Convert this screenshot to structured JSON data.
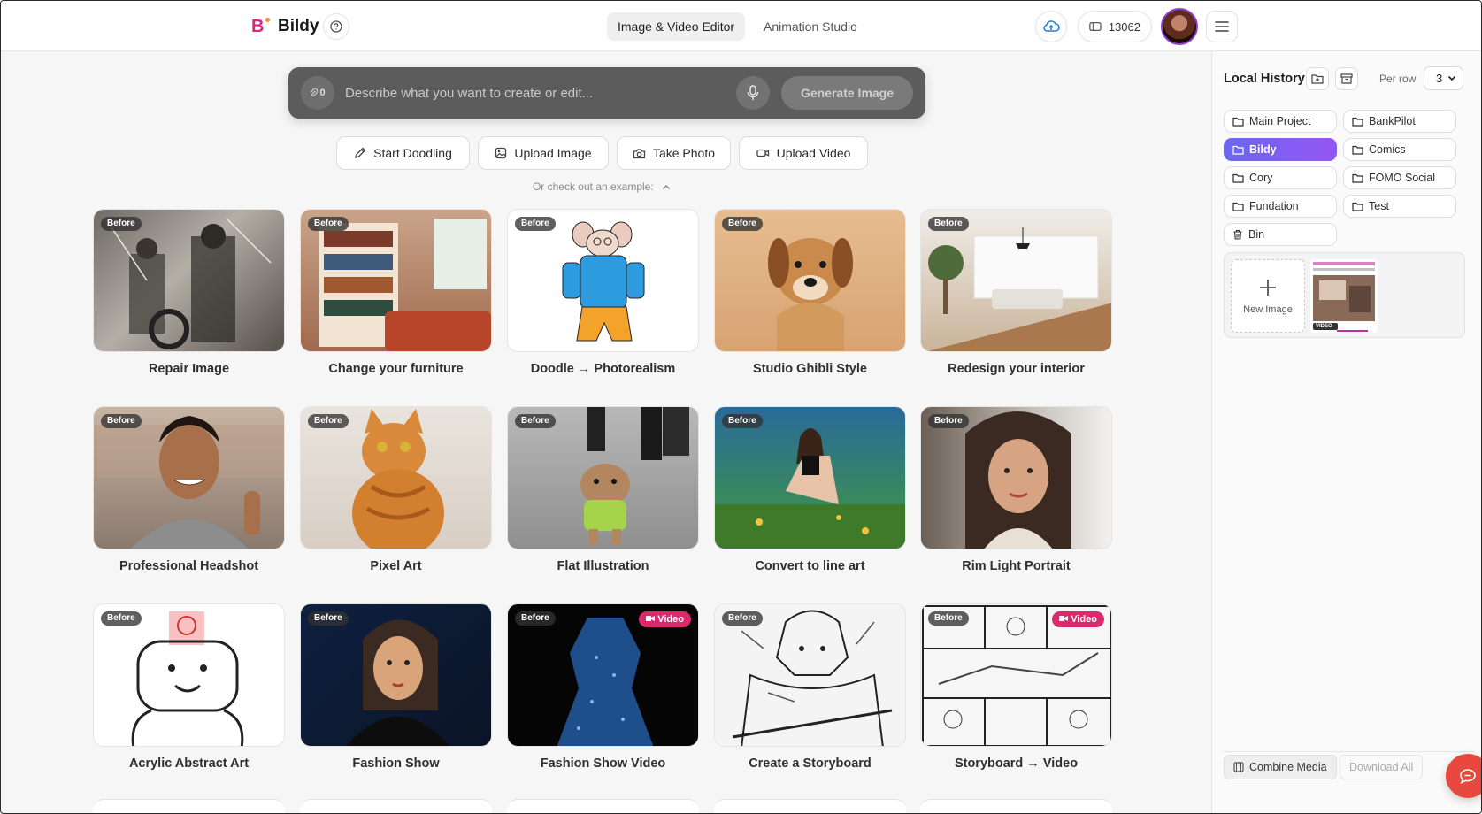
{
  "header": {
    "brand": "Bildy",
    "tabs": [
      {
        "label": "Image & Video Editor",
        "active": true
      },
      {
        "label": "Animation Studio",
        "active": false
      }
    ],
    "credits": "13062"
  },
  "prompt": {
    "attach_count": "0",
    "placeholder": "Describe what you want to create or edit...",
    "generate_label": "Generate Image"
  },
  "actions": {
    "doodle": "Start Doodling",
    "upload_image": "Upload Image",
    "take_photo": "Take Photo",
    "upload_video": "Upload Video"
  },
  "example_text": "Or check out an example:",
  "badge_before": "Before",
  "badge_video": "Video",
  "examples": [
    {
      "label": "Repair Image"
    },
    {
      "label": "Change your furniture"
    },
    {
      "label": "Doodle → Photorealism"
    },
    {
      "label": "Studio Ghibli Style"
    },
    {
      "label": "Redesign your interior"
    },
    {
      "label": "Professional Headshot"
    },
    {
      "label": "Pixel Art"
    },
    {
      "label": "Flat Illustration"
    },
    {
      "label": "Convert to line art"
    },
    {
      "label": "Rim Light Portrait"
    },
    {
      "label": "Acrylic Abstract Art"
    },
    {
      "label": "Fashion Show"
    },
    {
      "label": "Fashion Show Video"
    },
    {
      "label": "Create a Storyboard"
    },
    {
      "label": "Storyboard → Video"
    }
  ],
  "sidebar": {
    "title": "Local History",
    "per_row_label": "Per row",
    "per_row_value": "3",
    "folders": [
      {
        "label": "Main Project"
      },
      {
        "label": "BankPilot"
      },
      {
        "label": "Bildy",
        "active": true
      },
      {
        "label": "Comics"
      },
      {
        "label": "Cory"
      },
      {
        "label": "FOMO Social"
      },
      {
        "label": "Fundation"
      },
      {
        "label": "Test"
      },
      {
        "label": "Bin"
      }
    ],
    "new_image": "New Image",
    "thumb_tag": "VIDEO",
    "combine": "Combine Media",
    "download_all": "Download All"
  },
  "colors": {
    "accent_gradient_start": "#6a67f0",
    "accent_gradient_end": "#9654f5",
    "video_badge": "#d92a6d",
    "chat_button": "#e8493f"
  }
}
